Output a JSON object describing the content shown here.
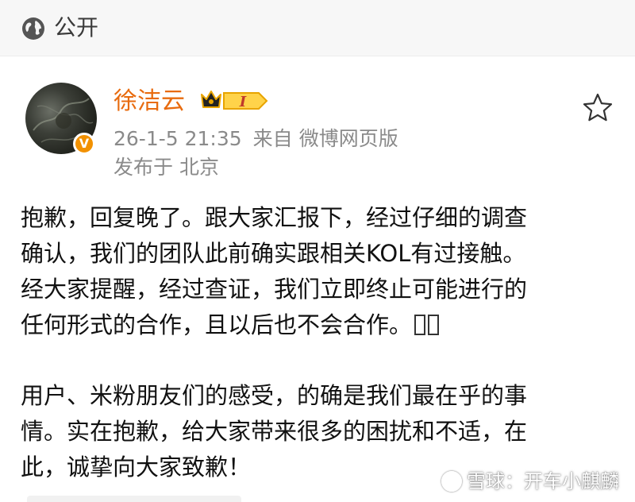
{
  "header": {
    "visibility_label": "公开",
    "visibility_icon": "globe-icon"
  },
  "author": {
    "name": "徐洁云",
    "verified_badge": "V",
    "level_badge_icon": "crown-level-badge-icon",
    "level_text": "I",
    "avatar_icon": "avatar-image"
  },
  "meta": {
    "timestamp": "26-1-5 21:35",
    "source_prefix": "来自",
    "source_client": "微博网页版",
    "location_prefix": "发布于",
    "location": "北京"
  },
  "actions": {
    "favorite_icon": "star-icon"
  },
  "post": {
    "paragraph1": [
      "抱歉，回复晚了。跟大家汇报下，经过仔细的调查",
      "确认，我们的团队此前确实跟相关KOL有过接触。",
      "经大家提醒，经过查证，我们立即终止可能进行的",
      "任何形式的合作，且以后也不会合作。"
    ],
    "paragraph2": [
      "用户、米粉朋友们的感受，的确是我们最在乎的事",
      "情。实在抱歉，给大家带来很多的困扰和不适，在",
      "此，诚挚向大家致歉！"
    ]
  },
  "watermark": {
    "text": "雪球：开车小麒麟"
  },
  "colors": {
    "username": "#e86b0f",
    "meta": "#8a8a8a",
    "verified": "#f29100",
    "crown": "#e8a400"
  }
}
